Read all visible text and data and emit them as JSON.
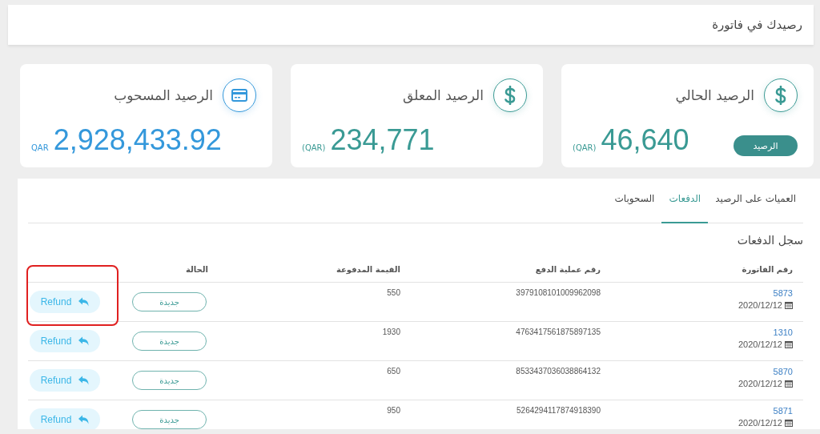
{
  "header": {
    "title": "رصيدك في فاتورة"
  },
  "cards": [
    {
      "kind": "dollar",
      "title": "الرصيد الحالي",
      "amount": "46,640",
      "currency": "(QAR)",
      "button": "الرصيد",
      "color": "#3a9a94"
    },
    {
      "kind": "dollar",
      "title": "الرصيد المعلق",
      "amount": "234,771",
      "currency": "(QAR)",
      "color": "#3a9a94"
    },
    {
      "kind": "card",
      "title": "الرصيد المسحوب",
      "amount": "2,928,433.92",
      "currency": "QAR",
      "color": "#3498db"
    }
  ],
  "tabs": [
    {
      "label": "العميات على الرصيد",
      "selected": false
    },
    {
      "label": "الدفعات",
      "selected": true
    },
    {
      "label": "السحوبات",
      "selected": false
    }
  ],
  "section_title": "سجل الدفعات",
  "table": {
    "columns": [
      "رقم الفاتورة",
      "رقم عملية الدفع",
      "القيمة المدفوعة",
      "الحالة"
    ],
    "rows": [
      {
        "invoice": "5873",
        "date": "2020/12/12",
        "payment_id": "3979108101009962098",
        "amount": "550",
        "status": "جديدة",
        "action": "Refund",
        "highlighted": true
      },
      {
        "invoice": "1310",
        "date": "2020/12/12",
        "payment_id": "4763417561875897135",
        "amount": "1930",
        "status": "جديدة",
        "action": "Refund",
        "highlighted": false
      },
      {
        "invoice": "5870",
        "date": "2020/12/12",
        "payment_id": "8533437036038864132",
        "amount": "650",
        "status": "جديدة",
        "action": "Refund",
        "highlighted": false
      },
      {
        "invoice": "5871",
        "date": "2020/12/12",
        "payment_id": "5264294117874918390",
        "amount": "950",
        "status": "جديدة",
        "action": "Refund",
        "highlighted": false
      }
    ]
  }
}
